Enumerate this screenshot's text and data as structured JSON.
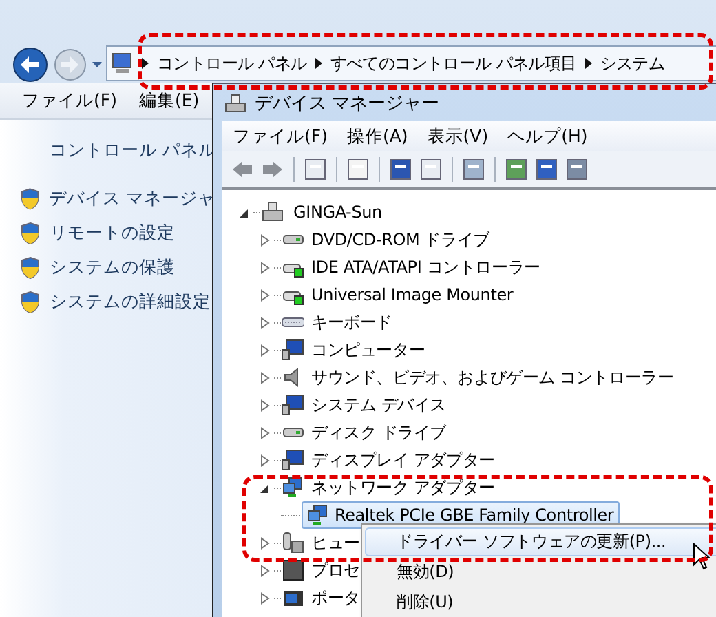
{
  "explorer": {
    "breadcrumbs": [
      "コントロール パネル",
      "すべてのコントロール パネル項目",
      "システム"
    ],
    "menu": [
      "ファイル(F)",
      "編集(E)"
    ],
    "pane_title": "コントロール パネル",
    "tasks": [
      "デバイス マネージャ",
      "リモートの設定",
      "システムの保護",
      "システムの詳細設定"
    ]
  },
  "device_manager": {
    "title": "デバイス マネージャー",
    "menu": [
      "ファイル(F)",
      "操作(A)",
      "表示(V)",
      "ヘルプ(H)"
    ],
    "tree": {
      "label": "GINGA-Sun",
      "kind": "computer",
      "expanded": true,
      "selected": false,
      "children": [
        {
          "label": "DVD/CD-ROM ドライブ",
          "kind": "drive",
          "expanded": false,
          "selected": false
        },
        {
          "label": "IDE ATA/ATAPI コントローラー",
          "kind": "controller",
          "expanded": false,
          "selected": false
        },
        {
          "label": "Universal Image Mounter",
          "kind": "controller",
          "expanded": false,
          "selected": false
        },
        {
          "label": "キーボード",
          "kind": "keyboard",
          "expanded": false,
          "selected": false
        },
        {
          "label": "コンピューター",
          "kind": "monitor",
          "expanded": false,
          "selected": false
        },
        {
          "label": "サウンド、ビデオ、およびゲーム コントローラー",
          "kind": "speaker",
          "expanded": false,
          "selected": false
        },
        {
          "label": "システム デバイス",
          "kind": "monitor",
          "expanded": false,
          "selected": false
        },
        {
          "label": "ディスク ドライブ",
          "kind": "drive",
          "expanded": false,
          "selected": false
        },
        {
          "label": "ディスプレイ アダプター",
          "kind": "monitor",
          "expanded": false,
          "selected": false
        },
        {
          "label": "ネットワーク アダプター",
          "kind": "network",
          "expanded": true,
          "selected": false,
          "children": [
            {
              "label": "Realtek PCIe GBE Family Controller",
              "kind": "network",
              "selected": true
            }
          ]
        },
        {
          "label": "ヒュー",
          "kind": "hid",
          "expanded": false,
          "selected": false
        },
        {
          "label": "プロセ",
          "kind": "chip",
          "expanded": false,
          "selected": false
        },
        {
          "label": "ポータ",
          "kind": "port",
          "expanded": false,
          "selected": false
        }
      ]
    }
  },
  "context_menu": [
    {
      "label": "ドライバー ソフトウェアの更新(P)...",
      "selected": true
    },
    {
      "label": "無効(D)",
      "selected": false
    },
    {
      "label": "削除(U)",
      "selected": false
    }
  ]
}
